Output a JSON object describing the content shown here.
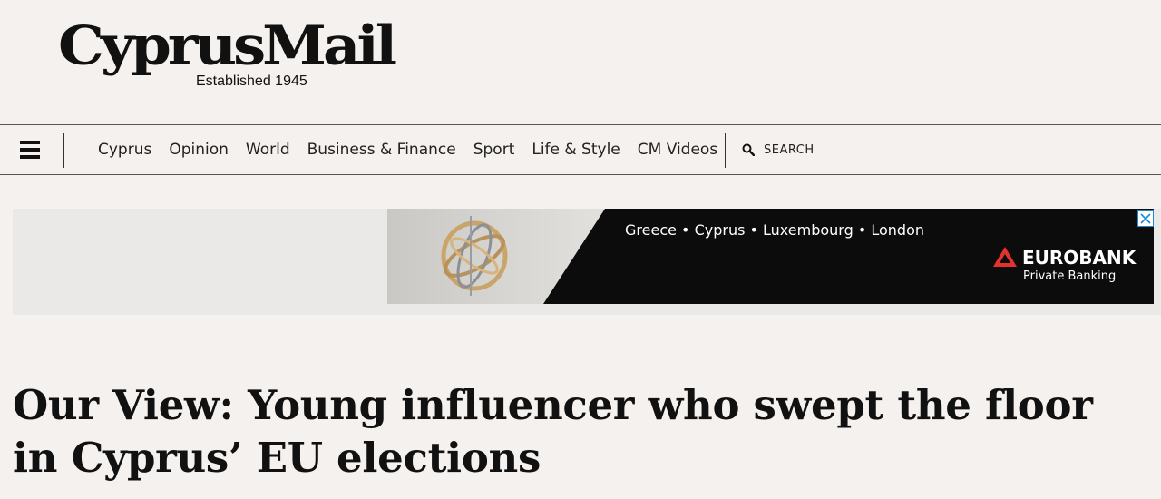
{
  "masthead": {
    "logo_text": "CyprusMail",
    "tagline": "Established 1945"
  },
  "nav": {
    "menu_icon": "hamburger-menu-icon",
    "items": [
      {
        "label": "Cyprus"
      },
      {
        "label": "Opinion"
      },
      {
        "label": "World"
      },
      {
        "label": "Business & Finance"
      },
      {
        "label": "Sport"
      },
      {
        "label": "Life & Style"
      },
      {
        "label": "CM Videos"
      }
    ],
    "search": {
      "icon": "search-icon",
      "label": "SEARCH"
    }
  },
  "ad": {
    "cities": "Greece • Cyprus • Luxembourg • London",
    "brand": "EUROBANK",
    "subtitle": "Private Banking",
    "brand_color": "#e4312b",
    "close_icon": "close-icon",
    "close_color": "#1a8bd6"
  },
  "article": {
    "headline": "Our View: Young influencer who swept the floor in Cyprus’ EU elections"
  }
}
